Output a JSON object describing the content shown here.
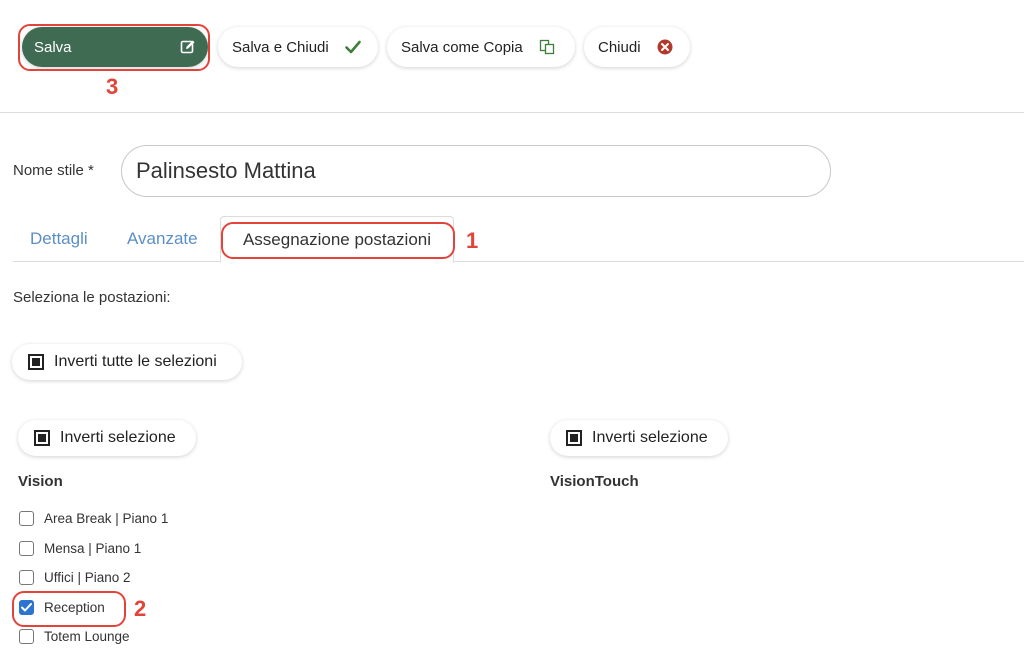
{
  "toolbar": {
    "save_label": "Salva",
    "save_close_label": "Salva e Chiudi",
    "save_copy_label": "Salva come Copia",
    "close_label": "Chiudi"
  },
  "form": {
    "name_label": "Nome stile *",
    "name_value": "Palinsesto Mattina"
  },
  "tabs": [
    {
      "label": "Dettagli",
      "active": false
    },
    {
      "label": "Avanzate",
      "active": false
    },
    {
      "label": "Assegnazione postazioni",
      "active": true
    }
  ],
  "assignment": {
    "select_label": "Seleziona le postazioni:",
    "invert_all_label": "Inverti tutte le selezioni",
    "groups": [
      {
        "title": "Vision",
        "invert_label": "Inverti selezione",
        "items": [
          {
            "label": "Area Break | Piano 1",
            "checked": false
          },
          {
            "label": "Mensa | Piano 1",
            "checked": false
          },
          {
            "label": "Uffici | Piano 2",
            "checked": false
          },
          {
            "label": "Reception",
            "checked": true
          },
          {
            "label": "Totem Lounge",
            "checked": false
          }
        ]
      },
      {
        "title": "VisionTouch",
        "invert_label": "Inverti selezione",
        "items": []
      }
    ]
  },
  "annotations": [
    "1",
    "2",
    "3"
  ],
  "colors": {
    "save_button_bg": "#3f6b52",
    "tab_link": "#5b8fc7",
    "checkbox_checked": "#2c73d2",
    "callout": "#e2443a",
    "check_icon": "#3f7d3a",
    "close_icon": "#b23a2c"
  },
  "icons": {
    "save": "edit-square-icon",
    "save_close": "checkmark-icon",
    "save_copy": "copy-icon",
    "close": "close-circle-icon"
  }
}
